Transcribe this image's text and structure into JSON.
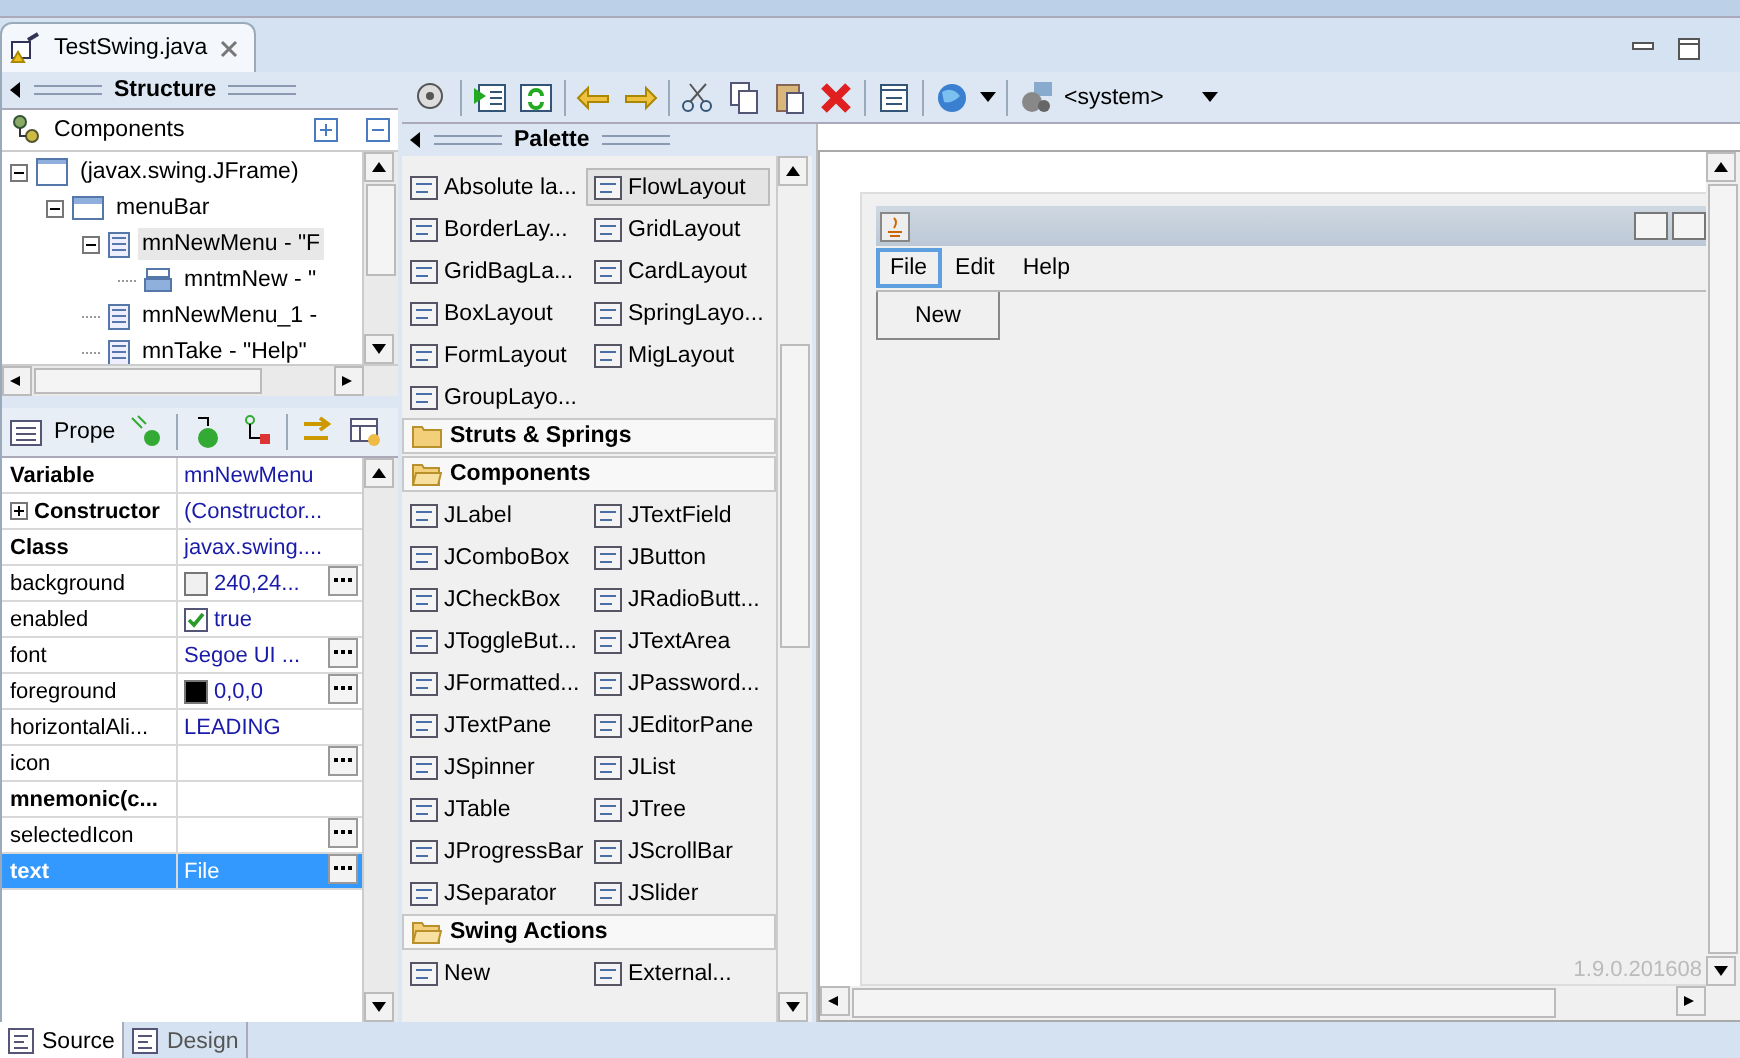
{
  "editor_tabs": [
    {
      "title": "TestSwing.java",
      "selected": true
    }
  ],
  "structure": {
    "title": "Structure",
    "components_label": "Components",
    "tree": [
      {
        "label": "(javax.swing.JFrame)",
        "kind": "frame",
        "expanded": true,
        "selected": false,
        "children": [
          {
            "label": "menuBar",
            "kind": "menubar",
            "expanded": true,
            "selected": false,
            "children": [
              {
                "label": "mnNewMenu - \"F",
                "kind": "menu",
                "expanded": true,
                "selected": true,
                "children": [
                  {
                    "label": "mntmNew - \"",
                    "kind": "menuitem",
                    "selected": false
                  }
                ]
              },
              {
                "label": "mnNewMenu_1 -",
                "kind": "menu",
                "selected": false
              },
              {
                "label": "mnTake - \"Help\"",
                "kind": "menu",
                "selected": false
              }
            ]
          }
        ]
      }
    ]
  },
  "properties": {
    "title": "Prope",
    "rows": [
      {
        "name": "Variable",
        "value": "mnNewMenu",
        "kind": "text",
        "bold": true,
        "editor": false,
        "selected": false
      },
      {
        "name": "Constructor",
        "value": "(Constructor...",
        "kind": "group",
        "bold": true,
        "editor": false,
        "selected": false
      },
      {
        "name": "Class",
        "value": "javax.swing....",
        "kind": "text",
        "bold": true,
        "editor": false,
        "selected": false
      },
      {
        "name": "background",
        "value": "240,24...",
        "kind": "color",
        "color": "#f0f0f0",
        "bold": false,
        "editor": true,
        "selected": false
      },
      {
        "name": "enabled",
        "value": "true",
        "kind": "check",
        "checked": true,
        "bold": false,
        "editor": false,
        "selected": false
      },
      {
        "name": "font",
        "value": "Segoe UI ...",
        "kind": "text",
        "bold": false,
        "editor": true,
        "selected": false
      },
      {
        "name": "foreground",
        "value": "0,0,0",
        "kind": "color",
        "color": "#000000",
        "bold": false,
        "editor": true,
        "selected": false
      },
      {
        "name": "horizontalAli...",
        "value": "LEADING",
        "kind": "text",
        "bold": false,
        "editor": false,
        "selected": false
      },
      {
        "name": "icon",
        "kind": "text",
        "bold": false,
        "editor": true,
        "selected": false
      },
      {
        "name": "mnemonic(c...",
        "kind": "text",
        "bold": true,
        "editor": false,
        "selected": false
      },
      {
        "name": "selectedIcon",
        "kind": "text",
        "bold": false,
        "editor": true,
        "selected": false
      },
      {
        "name": "text",
        "value": "File",
        "kind": "text",
        "bold": true,
        "editor": true,
        "selected": true
      }
    ]
  },
  "toolbar": {
    "system_label": "<system>"
  },
  "palette": {
    "title": "Palette",
    "sections": [
      {
        "expanded": true,
        "items": [
          {
            "label": "Absolute la...",
            "selected": false
          },
          {
            "label": "FlowLayout",
            "selected": true
          },
          {
            "label": "BorderLay...",
            "selected": false
          },
          {
            "label": "GridLayout",
            "selected": false
          },
          {
            "label": "GridBagLa...",
            "selected": false
          },
          {
            "label": "CardLayout",
            "selected": false
          },
          {
            "label": "BoxLayout",
            "selected": false
          },
          {
            "label": "SpringLayo...",
            "selected": false
          },
          {
            "label": "FormLayout",
            "selected": false
          },
          {
            "label": "MigLayout",
            "selected": false
          },
          {
            "label": "GroupLayo...",
            "selected": false
          }
        ]
      },
      {
        "title": "Struts & Springs",
        "expanded": false
      },
      {
        "title": "Components",
        "expanded": true,
        "items": [
          {
            "label": "JLabel",
            "selected": false
          },
          {
            "label": "JTextField",
            "selected": false
          },
          {
            "label": "JComboBox",
            "selected": false
          },
          {
            "label": "JButton",
            "selected": false
          },
          {
            "label": "JCheckBox",
            "selected": false
          },
          {
            "label": "JRadioButt...",
            "selected": false
          },
          {
            "label": "JToggleBut...",
            "selected": false
          },
          {
            "label": "JTextArea",
            "selected": false
          },
          {
            "label": "JFormatted...",
            "selected": false
          },
          {
            "label": "JPassword...",
            "selected": false
          },
          {
            "label": "JTextPane",
            "selected": false
          },
          {
            "label": "JEditorPane",
            "selected": false
          },
          {
            "label": "JSpinner",
            "selected": false
          },
          {
            "label": "JList",
            "selected": false
          },
          {
            "label": "JTable",
            "selected": false
          },
          {
            "label": "JTree",
            "selected": false
          },
          {
            "label": "JProgressBar",
            "selected": false
          },
          {
            "label": "JScrollBar",
            "selected": false
          },
          {
            "label": "JSeparator",
            "selected": false
          },
          {
            "label": "JSlider",
            "selected": false
          }
        ]
      },
      {
        "title": "Swing Actions",
        "expanded": true,
        "items": [
          {
            "label": "New",
            "selected": false
          },
          {
            "label": "External...",
            "selected": false
          }
        ]
      }
    ]
  },
  "canvas": {
    "menus": [
      {
        "label": "File",
        "selected": true
      },
      {
        "label": "Edit",
        "selected": false
      },
      {
        "label": "Help",
        "selected": false
      }
    ],
    "dropdown_items": [
      "New"
    ],
    "version": "1.9.0.201608"
  },
  "bottom_tabs": [
    {
      "label": "Source",
      "selected": true
    },
    {
      "label": "Design",
      "selected": false
    }
  ]
}
